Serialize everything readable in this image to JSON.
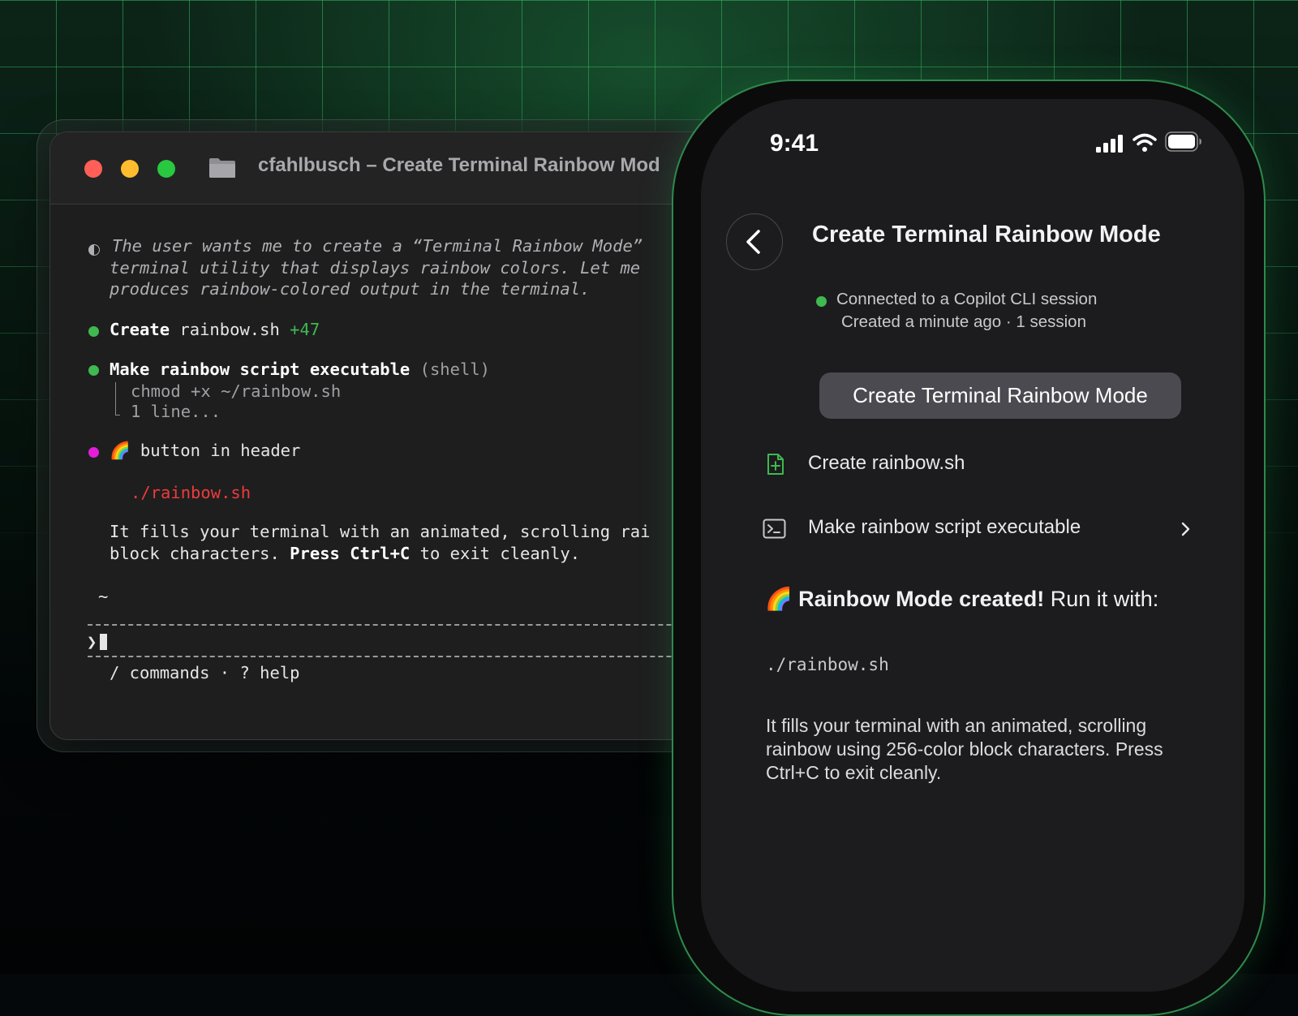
{
  "terminal": {
    "title": "cfahlbusch – Create Terminal Rainbow Mod",
    "thinking_lines": [
      "The user wants me to create a “Terminal Rainbow Mode”",
      "terminal utility that displays rainbow colors. Let me",
      "produces rainbow-colored output in the terminal."
    ],
    "step1": {
      "verb": "Create",
      "file": "rainbow.sh",
      "delta": "+47"
    },
    "step2": {
      "label": "Make rainbow script executable",
      "kind": "(shell)",
      "command": "chmod +x ~/rainbow.sh",
      "more": "1 line..."
    },
    "step3": {
      "emoji": "🌈",
      "text": "button in header"
    },
    "run_command": "./rainbow.sh",
    "desc_line1": "It fills your terminal with an animated, scrolling rai",
    "desc_line2_a": "block characters. ",
    "desc_line2_b": "Press Ctrl+C",
    "desc_line2_c": " to exit cleanly.",
    "cwd": "~",
    "prompt": "❯",
    "hint": "/ commands · ? help"
  },
  "phone": {
    "time": "9:41",
    "title": "Create Terminal Rainbow Mode",
    "connection": "Connected to a Copilot CLI session",
    "connection_sub": "Created a minute ago · 1 session",
    "user_message": "Create Terminal Rainbow Mode",
    "tool_rows": [
      {
        "label": "Create rainbow.sh",
        "icon": "file-plus-icon"
      },
      {
        "label": "Make rainbow script executable",
        "icon": "terminal-icon"
      }
    ],
    "result_emoji": "🌈",
    "result_bold": "Rainbow Mode created!",
    "result_rest": " Run it with:",
    "code": "./rainbow.sh",
    "paragraph": "It fills your terminal with an animated, scrolling rainbow using 256-color block characters. Press Ctrl+C to exit cleanly."
  },
  "colors": {
    "accent_green": "#3fb950",
    "error_red": "#ef3b3b",
    "magenta": "#e21fd6"
  }
}
